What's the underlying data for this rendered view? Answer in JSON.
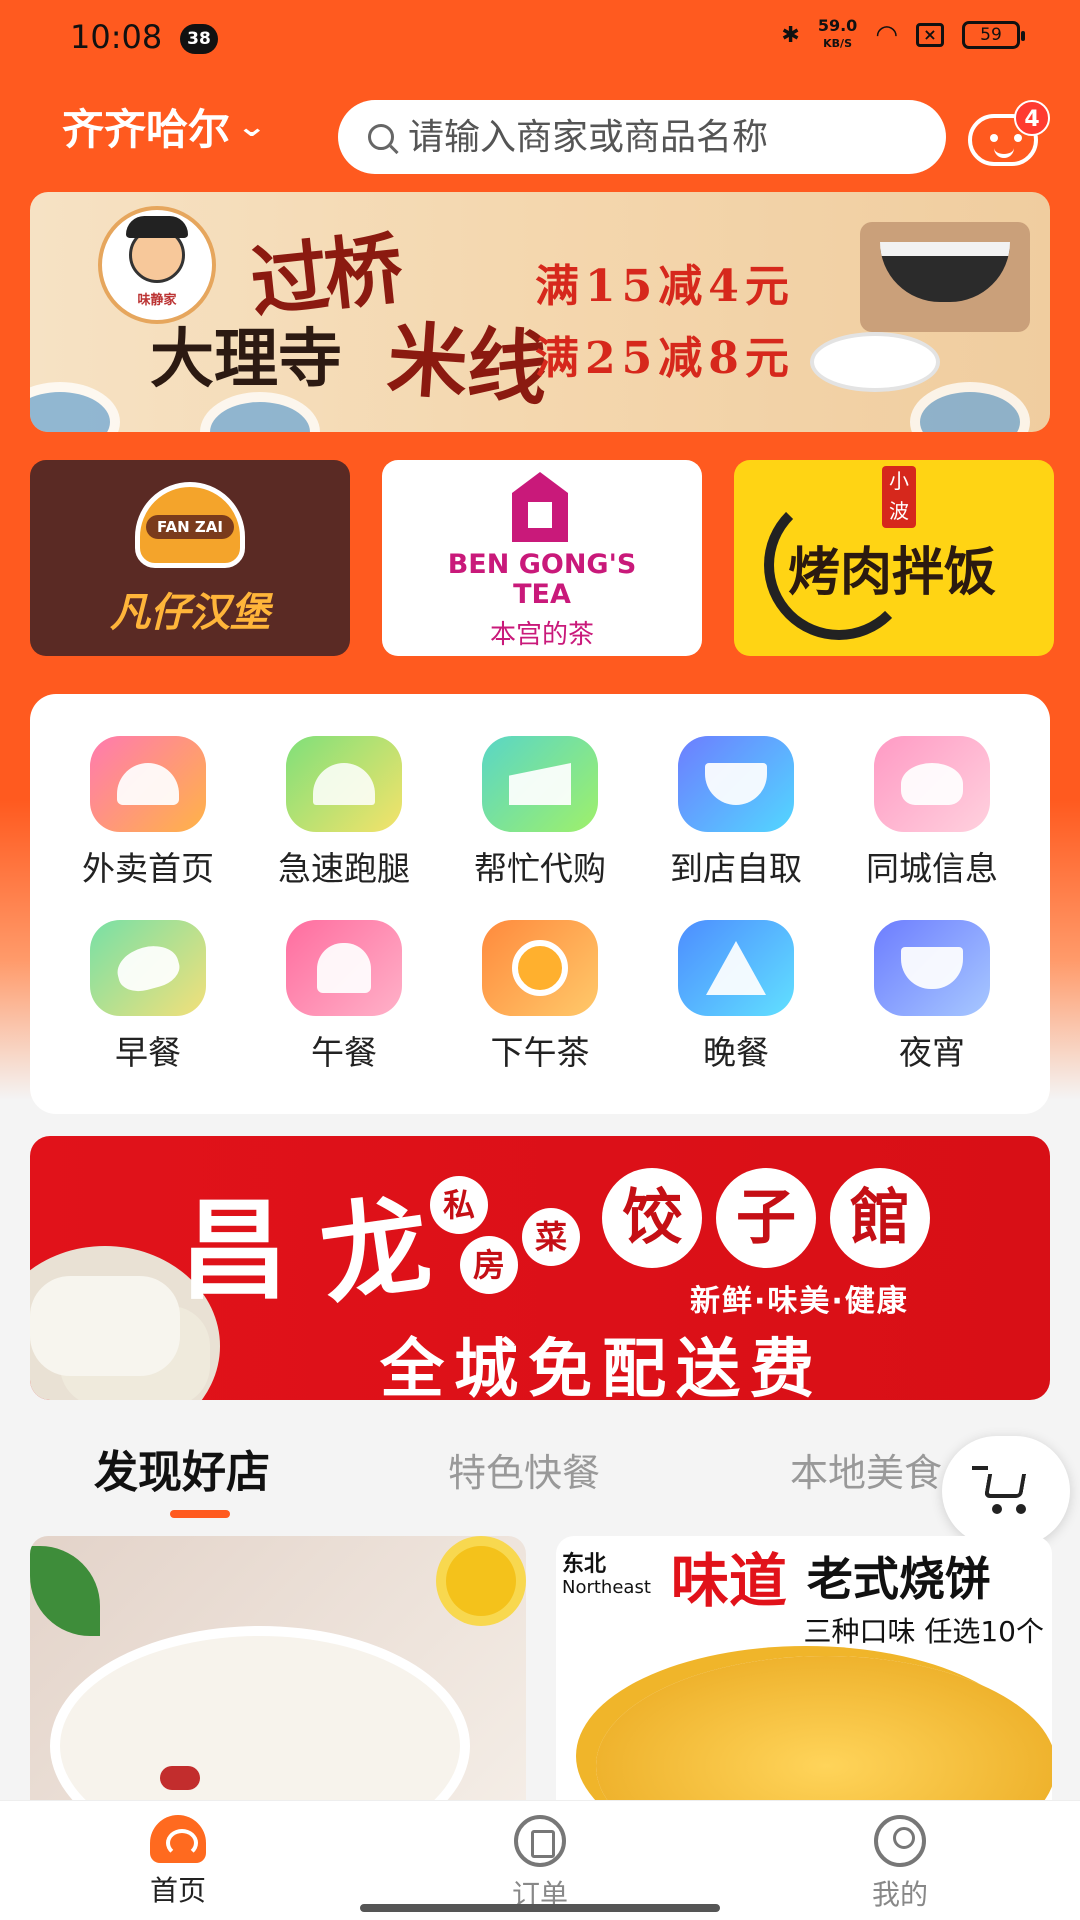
{
  "status_bar": {
    "time": "10:08",
    "notification_count": "38",
    "net_speed_value": "59.0",
    "net_speed_unit": "KB/S",
    "battery": "59"
  },
  "header": {
    "city": "齐齐哈尔",
    "search_placeholder": "请输入商家或商品名称",
    "message_count": "4"
  },
  "banner_top": {
    "brand": "味静家",
    "title_line1": "过桥",
    "title_line2": "大理寺",
    "title_line3": "米线",
    "promo1": "满15减4元",
    "promo2": "满25减8元"
  },
  "brands": [
    {
      "label": "凡仔汉堡",
      "logo_text": "FAN ZAI"
    },
    {
      "label_en_1": "BEN GONG'S",
      "label_en_2": "TEA",
      "label_cn": "本宫的茶"
    },
    {
      "label": "烤肉拌饭",
      "tag": "小波"
    }
  ],
  "categories": [
    {
      "label": "外卖首页",
      "icon": "cloche-icon"
    },
    {
      "label": "急速跑腿",
      "icon": "taco-icon"
    },
    {
      "label": "帮忙代购",
      "icon": "cake-icon"
    },
    {
      "label": "到店自取",
      "icon": "noodle-bowl-icon"
    },
    {
      "label": "同城信息",
      "icon": "bun-icon"
    },
    {
      "label": "早餐",
      "icon": "dumpling-icon"
    },
    {
      "label": "午餐",
      "icon": "cupcake-icon"
    },
    {
      "label": "下午茶",
      "icon": "orange-icon"
    },
    {
      "label": "晚餐",
      "icon": "rice-ball-icon"
    },
    {
      "label": "夜宵",
      "icon": "basket-icon"
    }
  ],
  "banner_mid": {
    "big1": "昌",
    "big2": "龙",
    "small1": "私",
    "small2": "房",
    "small3": "菜",
    "circle1": "饺",
    "circle2": "子",
    "circle3": "館",
    "slogan": "新鲜·味美·健康",
    "free": "全城免配送费"
  },
  "tabs": [
    "发现好店",
    "特色快餐",
    "本地美食"
  ],
  "shops": [
    {
      "image": "porridge"
    },
    {
      "nb1": "东北",
      "nb2": "Northeast",
      "weidao": "味道",
      "laoshi": "老式烧饼",
      "sub": "三种口味 任选10个"
    }
  ],
  "bottom_nav": [
    {
      "label": "首页",
      "active": true
    },
    {
      "label": "订单",
      "active": false
    },
    {
      "label": "我的",
      "active": false
    }
  ],
  "colors": {
    "brand_orange": "#ff5a1f",
    "banner_red": "#e1121a"
  }
}
